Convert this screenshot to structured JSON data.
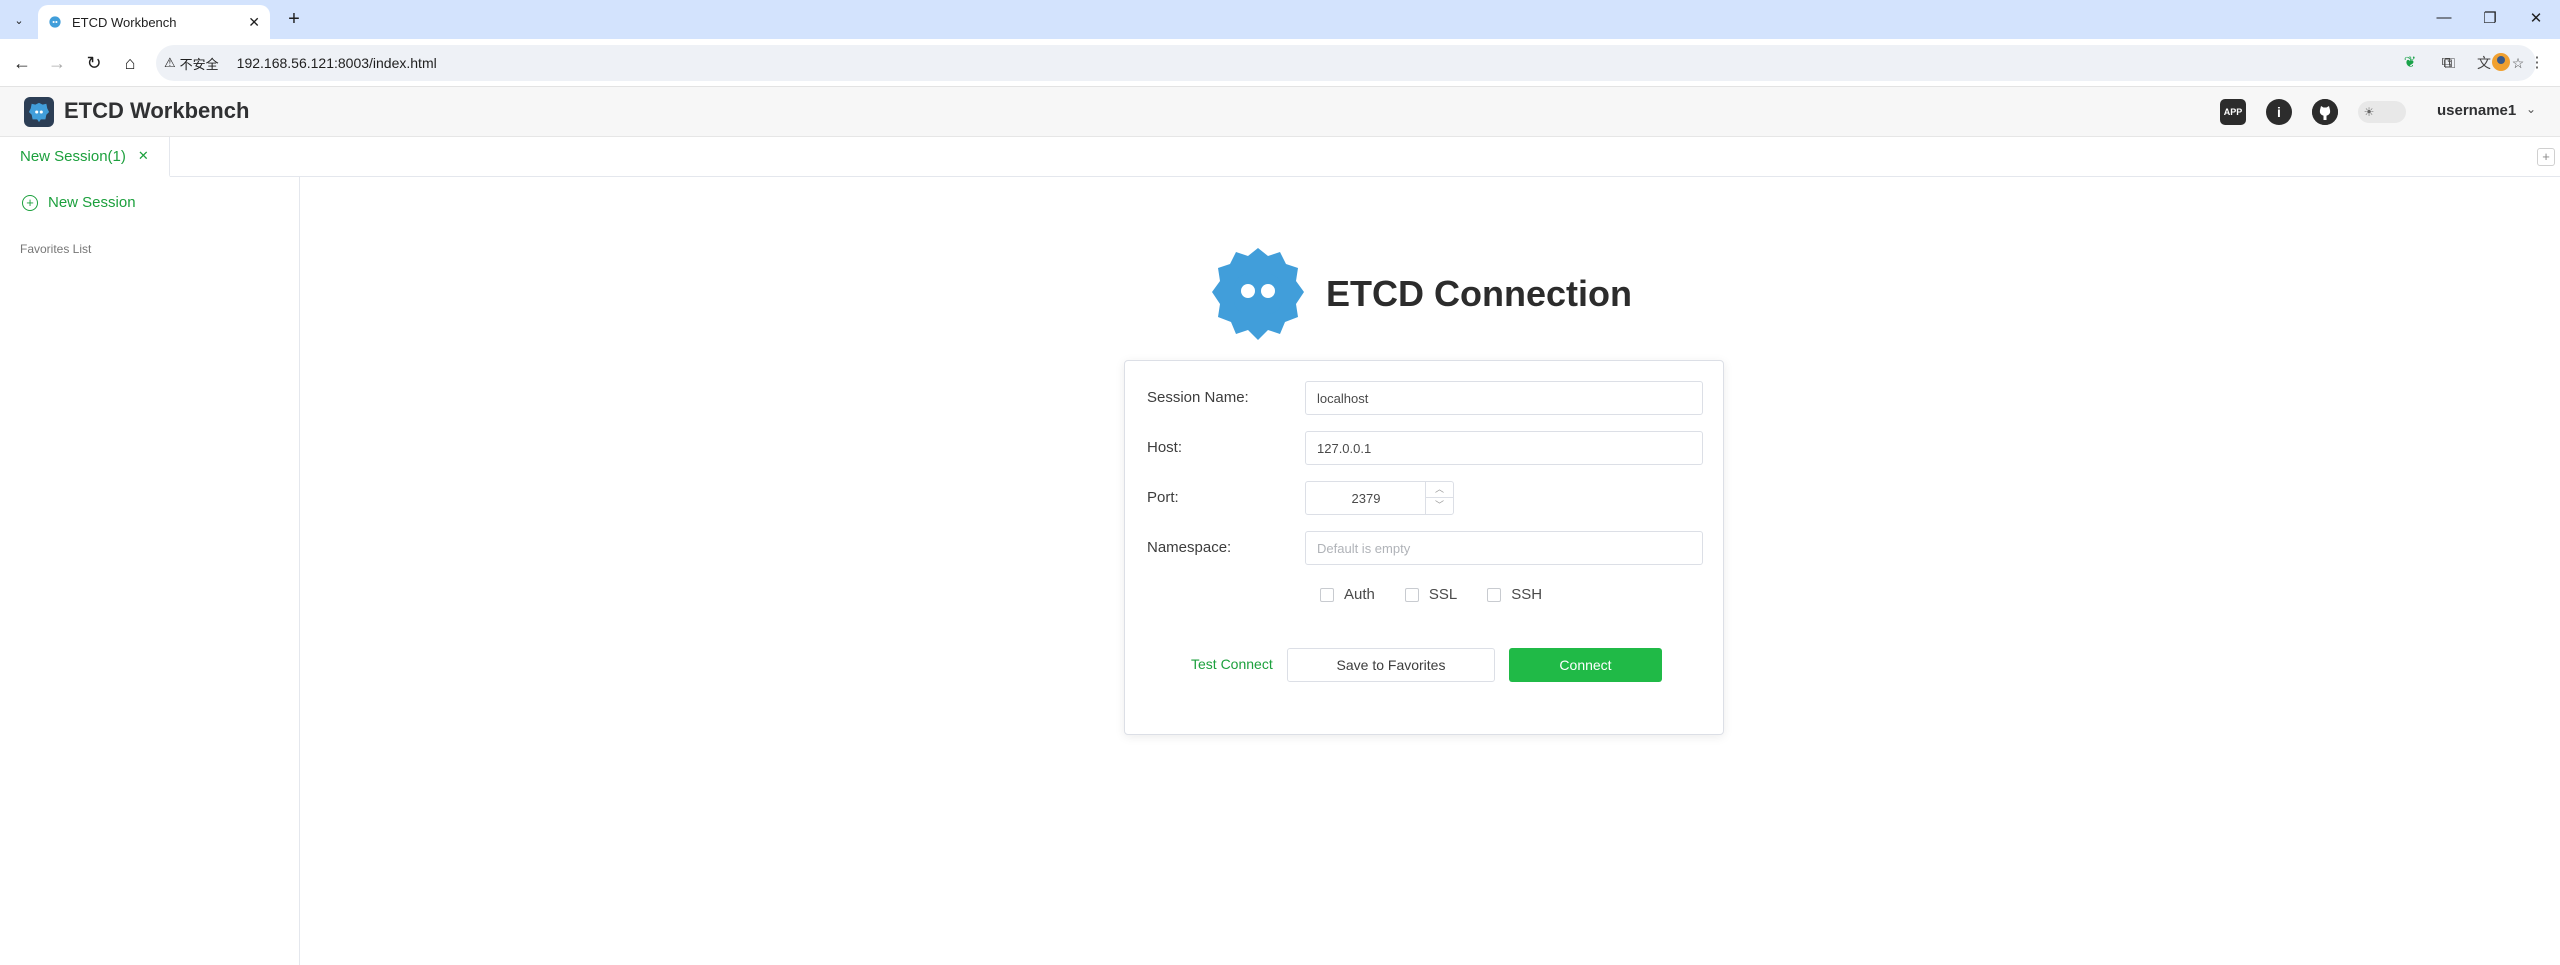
{
  "browser": {
    "tab_title": "ETCD Workbench",
    "security_label": "不安全",
    "url": "192.168.56.121:8003/index.html"
  },
  "app": {
    "title": "ETCD Workbench",
    "username": "username1",
    "header_icons": [
      "app-store-icon",
      "info-icon",
      "github-icon",
      "theme-toggle"
    ]
  },
  "session_tabs": [
    {
      "label": "New Session(1)",
      "active": true
    }
  ],
  "sidebar": {
    "new_session_label": "New Session",
    "favorites_title": "Favorites List"
  },
  "main": {
    "heading": "ETCD Connection",
    "form": {
      "session_name_label": "Session Name:",
      "session_name_value": "localhost",
      "host_label": "Host:",
      "host_value": "127.0.0.1",
      "port_label": "Port:",
      "port_value": "2379",
      "namespace_label": "Namespace:",
      "namespace_placeholder": "Default is empty",
      "checkboxes": [
        "Auth",
        "SSL",
        "SSH"
      ]
    },
    "buttons": {
      "test": "Test Connect",
      "save": "Save to Favorites",
      "connect": "Connect"
    }
  },
  "colors": {
    "accent": "#1ca03d",
    "connect_bg": "#20ba47",
    "logo_blue": "#419eda"
  }
}
